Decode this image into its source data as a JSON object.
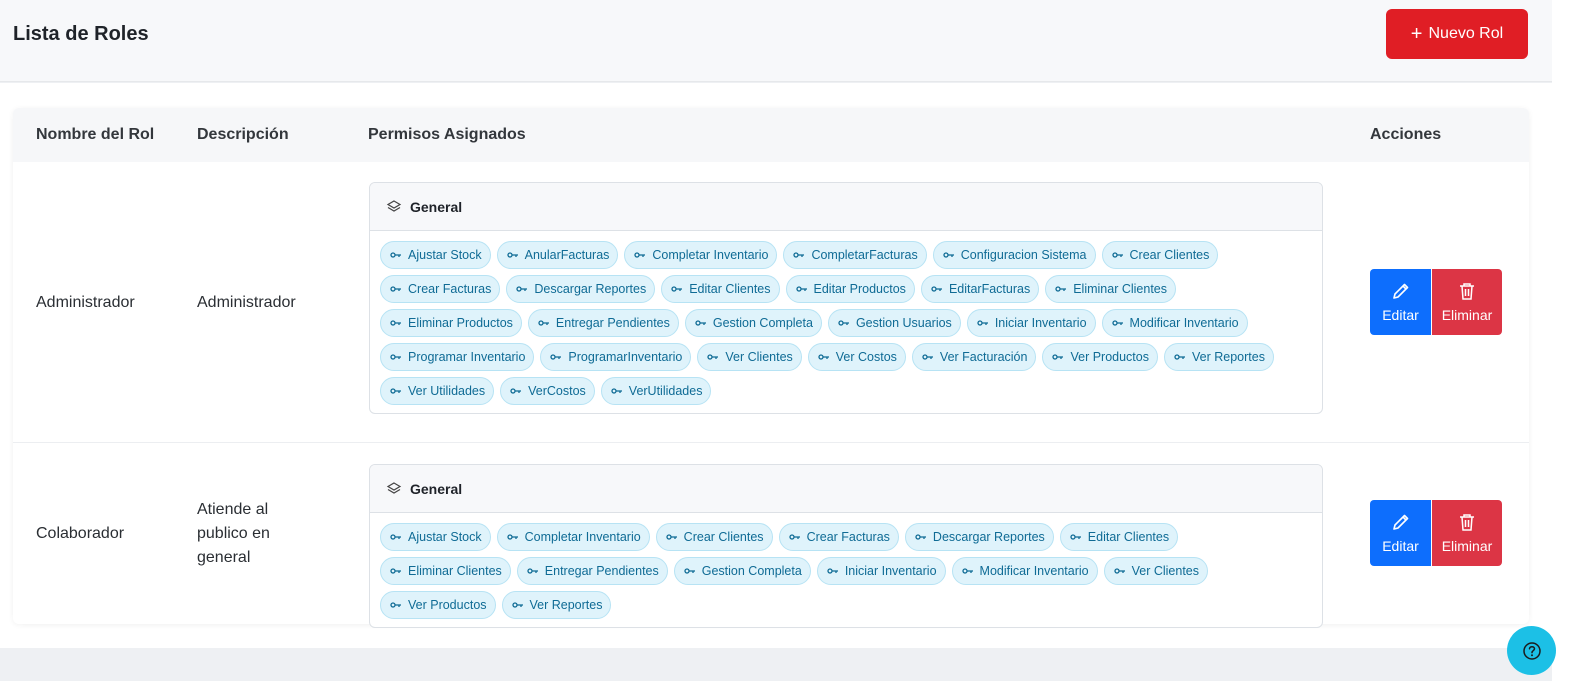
{
  "header": {
    "title": "Lista de Roles",
    "new_button_label": "Nuevo Rol"
  },
  "table": {
    "columns": {
      "name": "Nombre del Rol",
      "description": "Descripción",
      "permissions": "Permisos Asignados",
      "actions": "Acciones"
    },
    "rows": [
      {
        "name": "Administrador",
        "description": "Administrador",
        "group": "General",
        "permissions": [
          "Ajustar Stock",
          "AnularFacturas",
          "Completar Inventario",
          "CompletarFacturas",
          "Configuracion Sistema",
          "Crear Clientes",
          "Crear Facturas",
          "Descargar Reportes",
          "Editar Clientes",
          "Editar Productos",
          "EditarFacturas",
          "Eliminar Clientes",
          "Eliminar Productos",
          "Entregar Pendientes",
          "Gestion Completa",
          "Gestion Usuarios",
          "Iniciar Inventario",
          "Modificar Inventario",
          "Programar Inventario",
          "ProgramarInventario",
          "Ver Clientes",
          "Ver Costos",
          "Ver Facturación",
          "Ver Productos",
          "Ver Reportes",
          "Ver Utilidades",
          "VerCostos",
          "VerUtilidades"
        ]
      },
      {
        "name": "Colaborador",
        "description": "Atiende al publico en general",
        "group": "General",
        "permissions": [
          "Ajustar Stock",
          "Completar Inventario",
          "Crear Clientes",
          "Crear Facturas",
          "Descargar Reportes",
          "Editar Clientes",
          "Eliminar Clientes",
          "Entregar Pendientes",
          "Gestion Completa",
          "Iniciar Inventario",
          "Modificar Inventario",
          "Ver Clientes",
          "Ver Productos",
          "Ver Reportes"
        ]
      }
    ],
    "edit_label": "Editar",
    "delete_label": "Eliminar"
  },
  "colors": {
    "primary_red": "#e01e25",
    "edit_blue": "#0d6efd",
    "delete_red": "#dc3545",
    "chip_bg": "#dff3fb",
    "chip_text": "#0f6b95",
    "help_cyan": "#1cc0e6"
  },
  "icons": {
    "new_button": "plus-icon",
    "group": "layers-icon",
    "permission": "key-icon",
    "edit": "pencil-icon",
    "delete": "trash-icon",
    "help": "question-icon"
  }
}
